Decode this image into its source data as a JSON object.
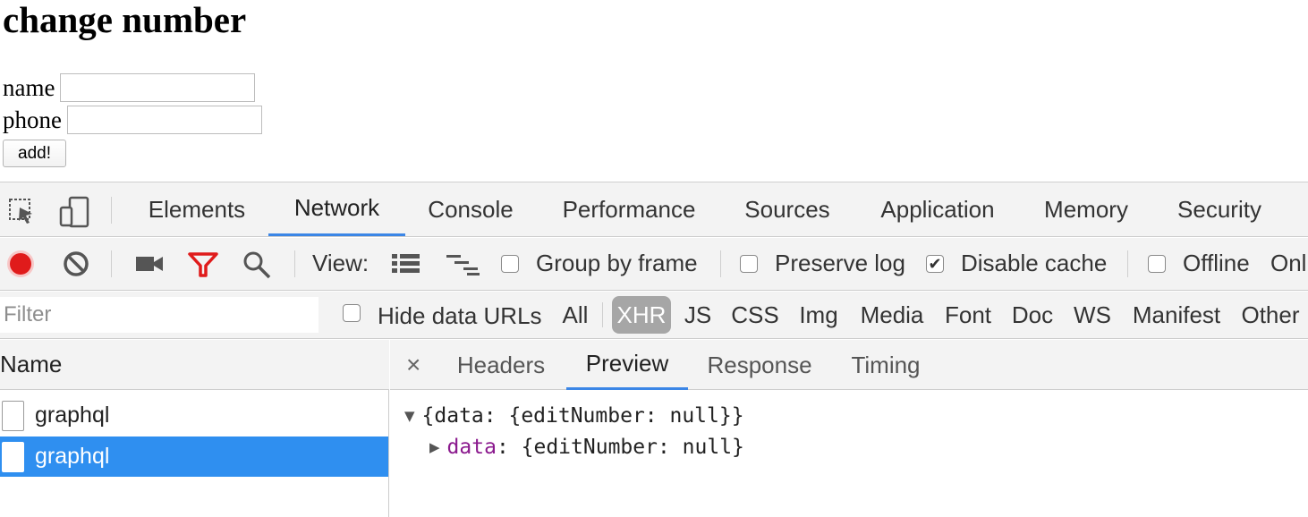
{
  "page": {
    "title": "change number",
    "form": {
      "name_label": "name",
      "name_value": "",
      "phone_label": "phone",
      "phone_value": "",
      "submit_label": "add!"
    }
  },
  "devtools": {
    "tabs": [
      "Elements",
      "Network",
      "Console",
      "Performance",
      "Sources",
      "Application",
      "Memory",
      "Security"
    ],
    "active_tab": "Network",
    "toolbar": {
      "view_label": "View:",
      "group_by_frame": {
        "label": "Group by frame",
        "checked": false
      },
      "preserve_log": {
        "label": "Preserve log",
        "checked": false
      },
      "disable_cache": {
        "label": "Disable cache",
        "checked": true
      },
      "offline": {
        "label": "Offline",
        "checked": false
      },
      "overflow_text": "Onl"
    },
    "filter": {
      "placeholder": "Filter",
      "hide_data_urls": {
        "label": "Hide data URLs",
        "checked": false
      },
      "types": [
        "All",
        "XHR",
        "JS",
        "CSS",
        "Img",
        "Media",
        "Font",
        "Doc",
        "WS",
        "Manifest",
        "Other"
      ],
      "active_type": "XHR"
    },
    "requests": {
      "header": "Name",
      "items": [
        {
          "name": "graphql",
          "selected": false
        },
        {
          "name": "graphql",
          "selected": true
        }
      ]
    },
    "detail": {
      "close_glyph": "×",
      "tabs": [
        "Headers",
        "Preview",
        "Response",
        "Timing"
      ],
      "active_tab": "Preview",
      "preview": {
        "root": "{data: {editNumber: null}}",
        "child_key": "data",
        "child_sep": ": ",
        "child_value": "{editNumber: null}"
      }
    },
    "colors": {
      "accent": "#3b86e6",
      "record": "#e01b1b",
      "filter_icon": "#e01b1b",
      "selected_row": "#2f8ff0",
      "json_key": "#8b1a8e"
    }
  }
}
